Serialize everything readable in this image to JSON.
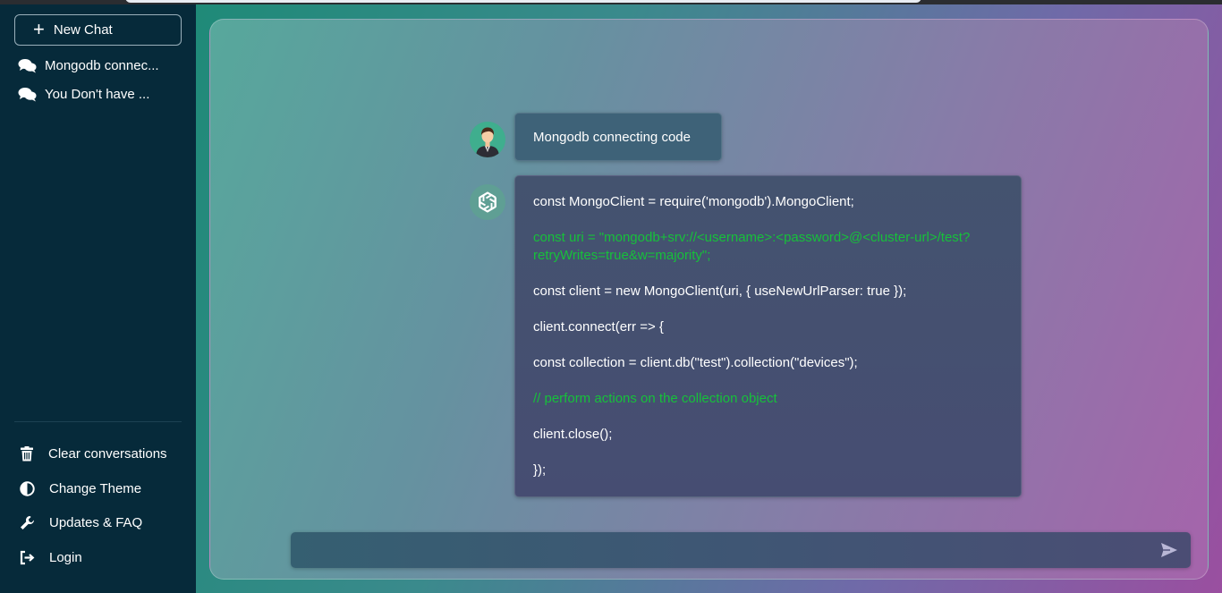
{
  "sidebar": {
    "new_chat_label": "New Chat",
    "conversations": [
      {
        "label": "Mongodb connec..."
      },
      {
        "label": "You Don't have ..."
      }
    ],
    "menu": [
      {
        "label": "Clear conversations",
        "icon": "trash-icon"
      },
      {
        "label": "Change Theme",
        "icon": "half-circle-icon"
      },
      {
        "label": "Updates & FAQ",
        "icon": "wrench-icon"
      },
      {
        "label": "Login",
        "icon": "logout-icon"
      }
    ]
  },
  "chat": {
    "user_message": "Mongodb connecting code",
    "bot_lines": [
      {
        "text": "const MongoClient = require('mongodb').MongoClient;",
        "style": "plain"
      },
      {
        "text": "const uri = \"mongodb+srv://<username>:<password>@<cluster-url>/test?retryWrites=true&w=majority\";",
        "style": "green"
      },
      {
        "text": "const client = new MongoClient(uri, { useNewUrlParser: true });",
        "style": "plain"
      },
      {
        "text": "client.connect(err => {",
        "style": "plain"
      },
      {
        "text": "const collection = client.db(\"test\").collection(\"devices\");",
        "style": "plain"
      },
      {
        "text": "// perform actions on the collection object",
        "style": "green"
      },
      {
        "text": "client.close();",
        "style": "plain"
      },
      {
        "text": "});",
        "style": "plain"
      }
    ]
  },
  "input": {
    "placeholder": "",
    "value": ""
  },
  "colors": {
    "sidebar_bg": "#062a3a",
    "bubble_bg": "#44536f",
    "code_green": "#16c13a"
  }
}
